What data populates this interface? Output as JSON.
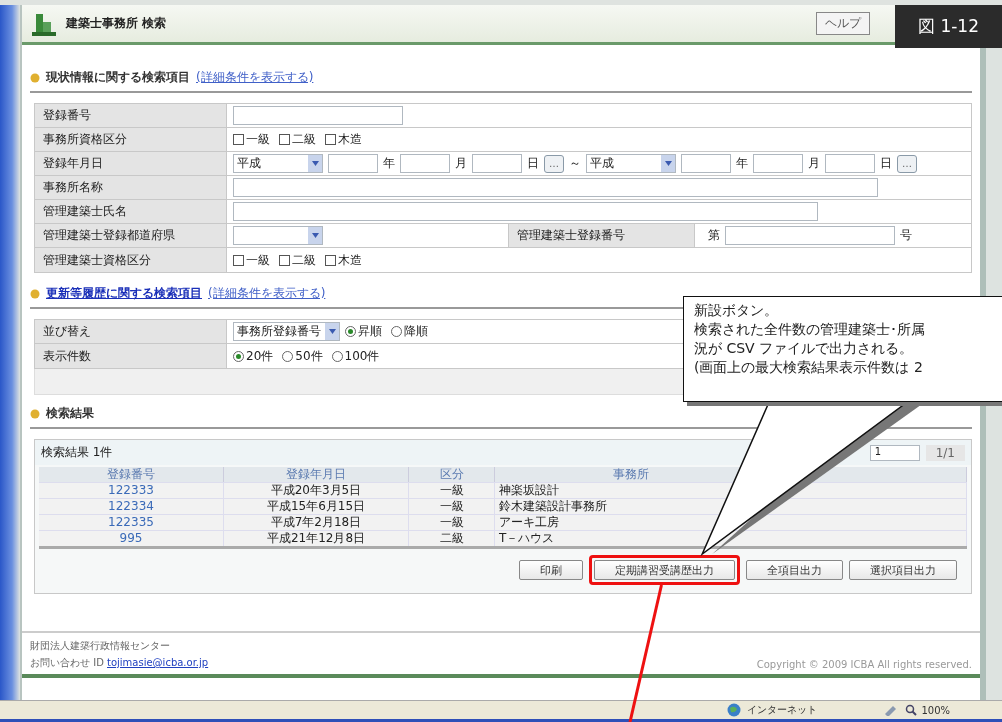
{
  "figure_label": "図 1-12",
  "header": {
    "title": "建築士事務所 検索",
    "help_button": "ヘルプ"
  },
  "search_sections": [
    {
      "title": "現状情報に関する検索項目",
      "title_is_link": false,
      "detail_link": "(詳細条件を表示する)",
      "rows": [
        {
          "label": "登録番号",
          "controls": [
            {
              "kind": "input"
            }
          ]
        },
        {
          "label": "事務所資格区分",
          "controls": [
            {
              "kind": "check",
              "label": "一級",
              "checked": false
            },
            {
              "kind": "check",
              "label": "二級",
              "checked": false
            },
            {
              "kind": "check",
              "label": "木造",
              "checked": false
            }
          ]
        },
        {
          "label": "登録年月日",
          "controls": [
            {
              "kind": "select",
              "value": "平成"
            },
            {
              "kind": "dateinput"
            },
            {
              "kind": "text",
              "text": "年"
            },
            {
              "kind": "dateinput"
            },
            {
              "kind": "text",
              "text": "月"
            },
            {
              "kind": "dateinput"
            },
            {
              "kind": "text",
              "text": "日"
            },
            {
              "kind": "picker",
              "text": "…"
            },
            {
              "kind": "text",
              "text": "～"
            },
            {
              "kind": "select",
              "value": "平成"
            },
            {
              "kind": "dateinput"
            },
            {
              "kind": "text",
              "text": "年"
            },
            {
              "kind": "dateinput"
            },
            {
              "kind": "text",
              "text": "月"
            },
            {
              "kind": "dateinput"
            },
            {
              "kind": "text",
              "text": "日"
            },
            {
              "kind": "picker",
              "text": "…"
            }
          ]
        },
        {
          "label": "事務所名称",
          "controls": [
            {
              "kind": "longinput"
            }
          ]
        },
        {
          "label": "管理建築士氏名",
          "controls": [
            {
              "kind": "nameinput"
            }
          ]
        },
        {
          "label": "管理建築士登録都道府県",
          "controls": [
            {
              "kind": "select"
            },
            {
              "kind": "th",
              "text": "管理建築士登録番号"
            },
            {
              "kind": "text",
              "text": "第"
            },
            {
              "kind": "input"
            },
            {
              "kind": "text",
              "text": "号"
            }
          ]
        },
        {
          "label": "管理建築士資格区分",
          "controls": [
            {
              "kind": "check",
              "label": "一級",
              "checked": false
            },
            {
              "kind": "check",
              "label": "二級",
              "checked": false
            },
            {
              "kind": "check",
              "label": "木造",
              "checked": false
            }
          ]
        }
      ]
    },
    {
      "title": "更新等履歴に関する検索項目",
      "title_is_link": true,
      "detail_link": "(詳細条件を表示する)",
      "rows": [
        {
          "label": "並び替え",
          "controls": [
            {
              "kind": "select",
              "value": "事務所登録番号"
            },
            {
              "kind": "radio",
              "label": "昇順",
              "selected": true
            },
            {
              "kind": "radio",
              "label": "降順",
              "selected": false
            }
          ]
        },
        {
          "label": "表示件数",
          "controls": [
            {
              "kind": "radio",
              "label": "20件",
              "selected": true
            },
            {
              "kind": "radio",
              "label": "50件",
              "selected": false
            },
            {
              "kind": "radio",
              "label": "100件",
              "selected": false
            }
          ]
        }
      ]
    }
  ],
  "results": {
    "title": "検索結果",
    "count_label": "検索結果 1件",
    "page_input": "1",
    "page_count": "1/1",
    "columns": [
      "登録番号",
      "登録年月日",
      "区分",
      "事務所"
    ],
    "rows": [
      [
        "122333",
        "平成20年3月5日",
        "一級",
        "神楽坂設計"
      ],
      [
        "122334",
        "平成15年6月15日",
        "一級",
        "鈴木建築設計事務所"
      ],
      [
        "122335",
        "平成7年2月18日",
        "一級",
        "アーキ工房"
      ],
      [
        "995",
        "平成21年12月8日",
        "二級",
        "T－ハウス"
      ]
    ],
    "buttons": [
      {
        "label": "印刷",
        "highlighted": false
      },
      {
        "label": "定期講習受講歴出力",
        "highlighted": true
      },
      {
        "label": "全項目出力",
        "highlighted": false
      },
      {
        "label": "選択項目出力",
        "highlighted": false
      }
    ]
  },
  "footer": {
    "organization": "財団法人建築行政情報センター",
    "contact_label": "お問い合わせ ID",
    "contact_link": "tojimasie@icba.or.jp",
    "copyright": "Copyright © 2009 ICBA All rights reserved."
  },
  "status_bar": {
    "zone": "インターネット",
    "zoom": "100%"
  },
  "callout": {
    "lines": [
      "新設ボタン。",
      "検索された全件数の管理建築士･所属",
      "況が CSV ファイルで出力される。",
      "(画面上の最大検索結果表示件数は 2"
    ]
  }
}
